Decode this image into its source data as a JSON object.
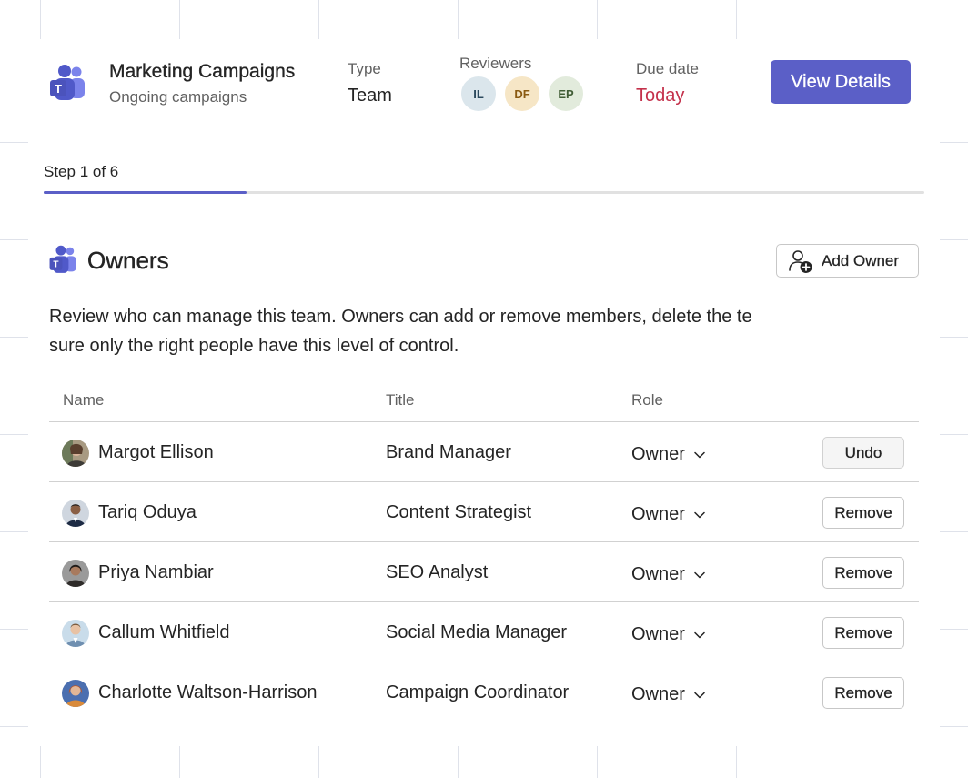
{
  "header": {
    "team_name": "Marketing Campaigns",
    "team_subtitle": "Ongoing campaigns",
    "type_label": "Type",
    "type_value": "Team",
    "reviewers_label": "Reviewers",
    "reviewers": [
      {
        "initials": "IL",
        "bg": "#dbe6ec",
        "color": "#2c4a5e"
      },
      {
        "initials": "DF",
        "bg": "#f6e6c6",
        "color": "#8a5a12"
      },
      {
        "initials": "EP",
        "bg": "#e2ebdc",
        "color": "#405c35"
      }
    ],
    "due_label": "Due date",
    "due_value": "Today",
    "view_details_label": "View Details"
  },
  "progress": {
    "step_label": "Step 1 of 6",
    "fraction": 0.23
  },
  "section": {
    "title": "Owners",
    "add_owner_label": "Add Owner",
    "description": "Review who can manage this team. Owners can add or remove members, delete the te sure only the right people have this level of control."
  },
  "table": {
    "columns": {
      "name": "Name",
      "title": "Title",
      "role": "Role"
    },
    "rows": [
      {
        "name": "Margot Ellison",
        "title": "Brand Manager",
        "role": "Owner",
        "action": "Undo"
      },
      {
        "name": "Tariq Oduya",
        "title": "Content Strategist",
        "role": "Owner",
        "action": "Remove"
      },
      {
        "name": "Priya Nambiar",
        "title": "SEO Analyst",
        "role": "Owner",
        "action": "Remove"
      },
      {
        "name": "Callum Whitfield",
        "title": "Social Media Manager",
        "role": "Owner",
        "action": "Remove"
      },
      {
        "name": "Charlotte Waltson-Harrison",
        "title": "Campaign Coordinator",
        "role": "Owner",
        "action": "Remove"
      }
    ]
  },
  "colors": {
    "accent": "#5b5fc7",
    "due_today": "#c4314b"
  }
}
